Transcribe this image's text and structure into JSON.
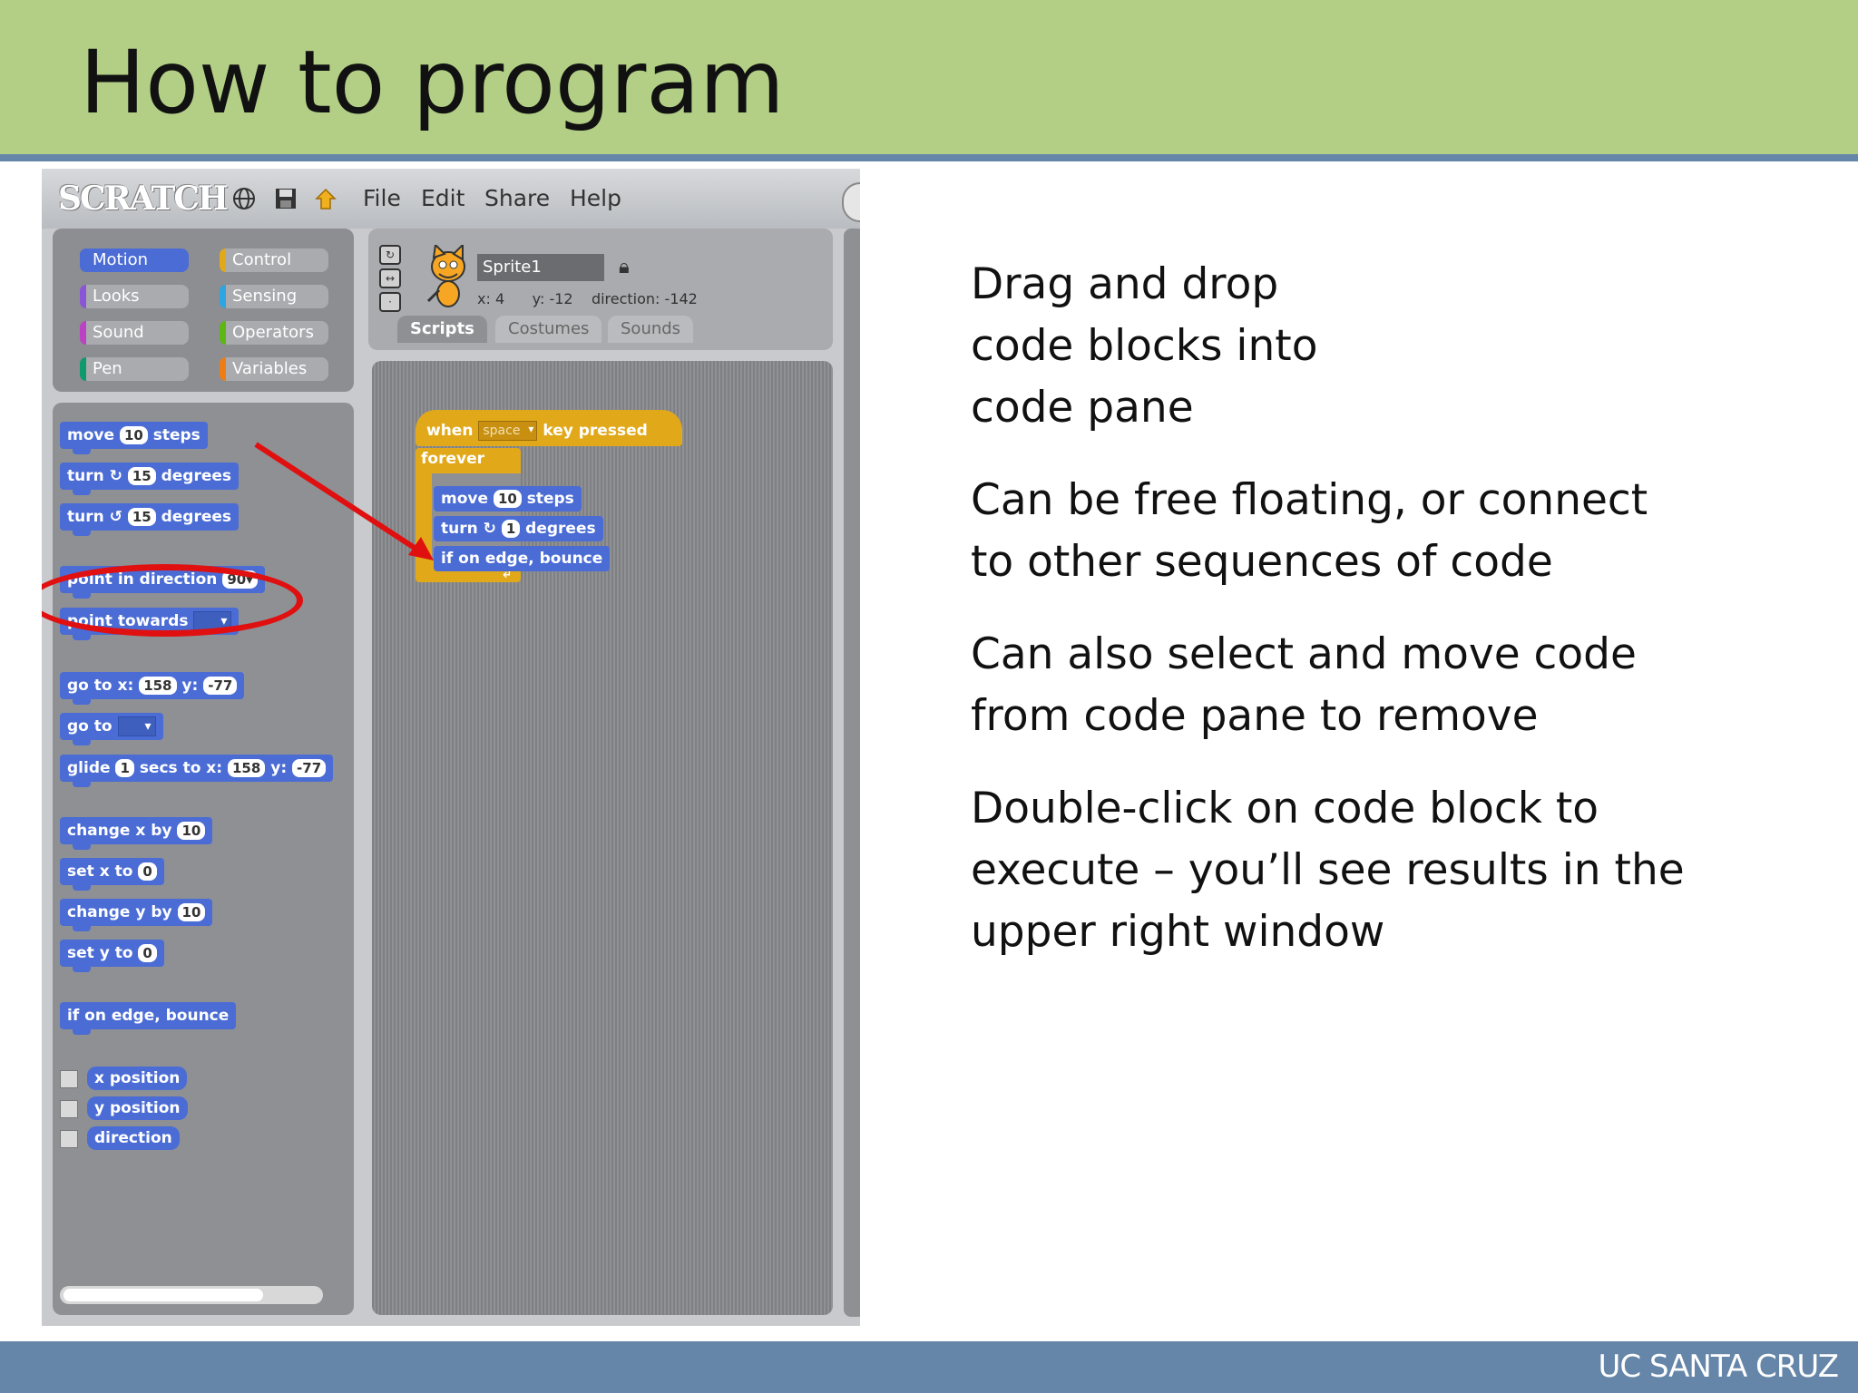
{
  "slide": {
    "title": "How to program",
    "footer": "UC SANTA CRUZ",
    "bullets": [
      [
        "Drag and drop",
        "code blocks into",
        "code pane"
      ],
      [
        "Can be free floating, or connect",
        "to other sequences of code"
      ],
      [
        "Can also select and move code",
        "from code pane to remove"
      ],
      [
        "Double-click on code block to",
        "execute – you’ll see results in the",
        "upper right window"
      ]
    ]
  },
  "scratch": {
    "logo": "SCRATCH",
    "menu": [
      "File",
      "Edit",
      "Share",
      "Help"
    ],
    "categories": [
      {
        "label": "Motion",
        "color": "#4a6cd4"
      },
      {
        "label": "Control",
        "color": "#e1a91a"
      },
      {
        "label": "Looks",
        "color": "#8a55d7"
      },
      {
        "label": "Sensing",
        "color": "#2ca5e2"
      },
      {
        "label": "Sound",
        "color": "#bb42c3"
      },
      {
        "label": "Operators",
        "color": "#5cb712"
      },
      {
        "label": "Pen",
        "color": "#0e9a6c"
      },
      {
        "label": "Variables",
        "color": "#ee7d16"
      }
    ],
    "sprite": {
      "name": "Sprite1",
      "x_label": "x:",
      "x": "4",
      "y_label": "y:",
      "y": "-12",
      "direction_label": "direction:",
      "direction": "-142"
    },
    "tabs": [
      "Scripts",
      "Costumes",
      "Sounds"
    ],
    "palette": {
      "move": {
        "a": "move",
        "n": "10",
        "b": "steps"
      },
      "turn_cw": {
        "a": "turn",
        "icon": "↻",
        "n": "15",
        "b": "degrees"
      },
      "turn_ccw": {
        "a": "turn",
        "icon": "↺",
        "n": "15",
        "b": "degrees"
      },
      "point_dir": {
        "a": "point in direction",
        "n": "90▾"
      },
      "point_towards": {
        "a": "point towards"
      },
      "goto_xy": {
        "a": "go to x:",
        "x": "158",
        "y_label": "y:",
        "y": "-77"
      },
      "goto": {
        "a": "go to"
      },
      "glide": {
        "a": "glide",
        "n": "1",
        "b": "secs to x:",
        "x": "158",
        "y_label": "y:",
        "y": "-77"
      },
      "change_x": {
        "a": "change x by",
        "n": "10"
      },
      "set_x": {
        "a": "set x to",
        "n": "0"
      },
      "change_y": {
        "a": "change y by",
        "n": "10"
      },
      "set_y": {
        "a": "set y to",
        "n": "0"
      },
      "bounce": {
        "a": "if on edge, bounce"
      },
      "reporters": [
        "x position",
        "y position",
        "direction"
      ]
    },
    "script": {
      "hat": {
        "a": "when",
        "key": "space",
        "b": "key pressed"
      },
      "forever": "forever",
      "move": {
        "a": "move",
        "n": "10",
        "b": "steps"
      },
      "turn": {
        "a": "turn",
        "icon": "↻",
        "n": "1",
        "b": "degrees"
      },
      "bounce": "if on edge, bounce"
    }
  }
}
